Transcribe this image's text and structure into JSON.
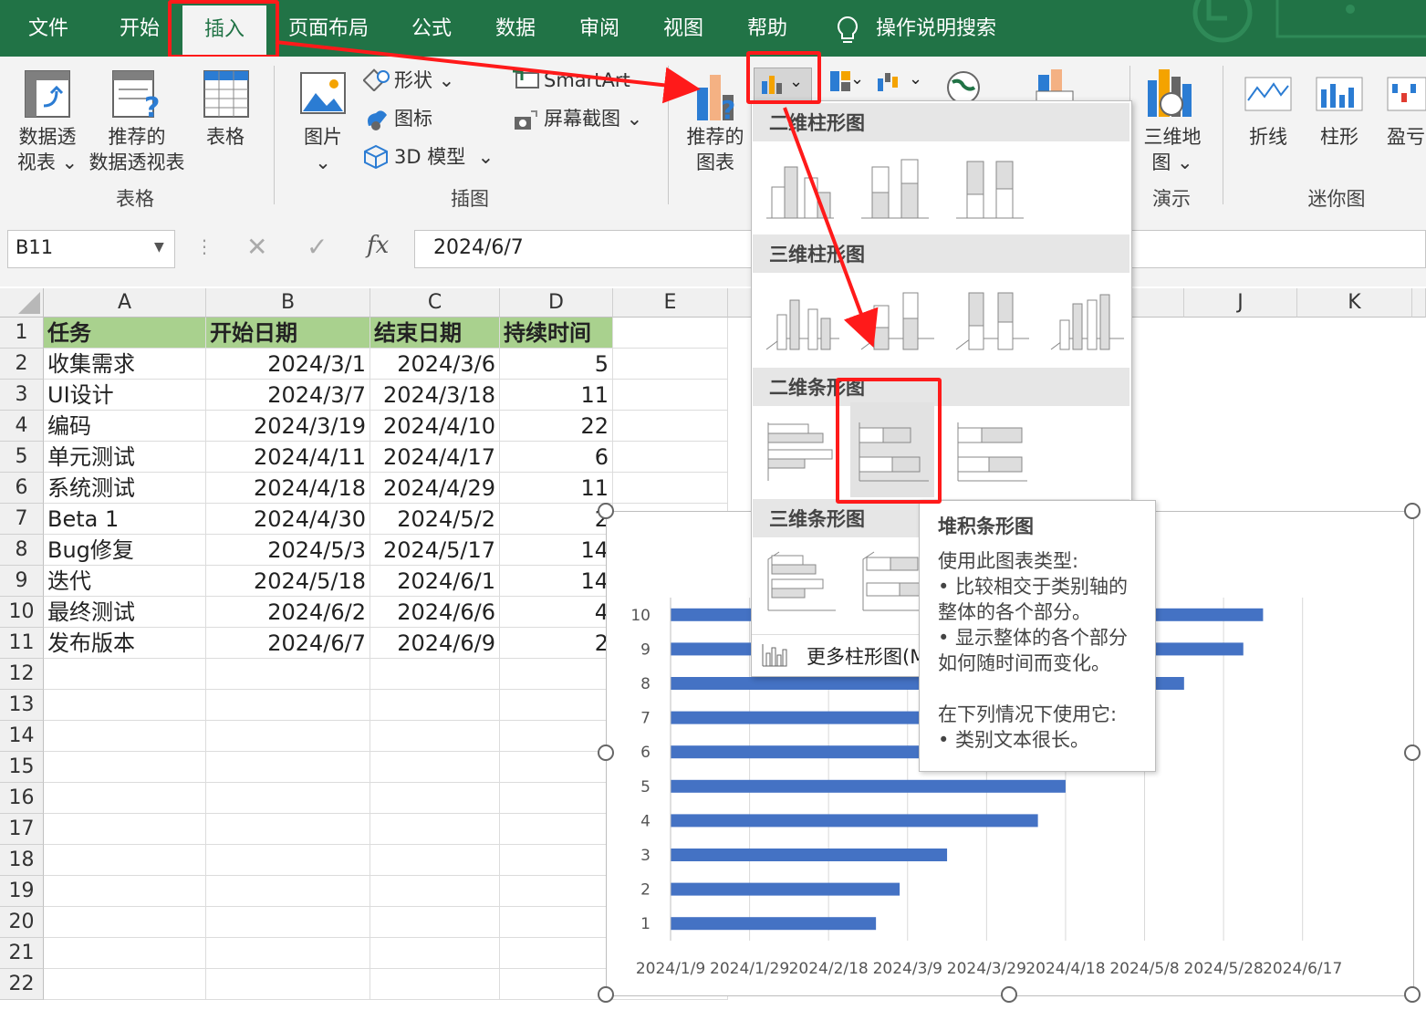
{
  "menu": {
    "items": [
      "文件",
      "开始",
      "插入",
      "页面布局",
      "公式",
      "数据",
      "审阅",
      "视图",
      "帮助"
    ],
    "active": "插入",
    "search_label": "操作说明搜索"
  },
  "ribbon": {
    "pivot_label_1": "数据透",
    "pivot_label_2": "视表",
    "rec_pivot_label_1": "推荐的",
    "rec_pivot_label_2": "数据透视表",
    "table_label": "表格",
    "group_table": "表格",
    "picture_label": "图片",
    "shapes_label": "形状",
    "icons_label": "图标",
    "model3d_label": "3D 模型",
    "smartart_label": "SmartArt",
    "screenshot_label": "屏幕截图",
    "group_illustrations": "插图",
    "rec_chart_label_1": "推荐的",
    "rec_chart_label_2": "图表",
    "map3d_label_1": "三维地",
    "map3d_label_2": "图",
    "group_tours": "演示",
    "spark_line": "折线",
    "spark_column": "柱形",
    "spark_winloss": "盈亏",
    "group_sparklines": "迷你图"
  },
  "formula_bar": {
    "name_box": "B11",
    "fx": "fx",
    "value": "2024/6/7"
  },
  "columns": [
    "A",
    "B",
    "C",
    "D",
    "E",
    "J",
    "K"
  ],
  "rows": [
    "1",
    "2",
    "3",
    "4",
    "5",
    "6",
    "7",
    "8",
    "9",
    "10",
    "11",
    "12",
    "13",
    "14",
    "15",
    "16",
    "17",
    "18",
    "19",
    "20",
    "21",
    "22"
  ],
  "table": {
    "headers": [
      "任务",
      "开始日期",
      "结束日期",
      "持续时间"
    ],
    "rows": [
      [
        "收集需求",
        "2024/3/1",
        "2024/3/6",
        "5"
      ],
      [
        "UI设计",
        "2024/3/7",
        "2024/3/18",
        "11"
      ],
      [
        "编码",
        "2024/3/19",
        "2024/4/10",
        "22"
      ],
      [
        "单元测试",
        "2024/4/11",
        "2024/4/17",
        "6"
      ],
      [
        "系统测试",
        "2024/4/18",
        "2024/4/29",
        "11"
      ],
      [
        "Beta 1",
        "2024/4/30",
        "2024/5/2",
        "2"
      ],
      [
        "Bug修复",
        "2024/5/3",
        "2024/5/17",
        "14"
      ],
      [
        "迭代",
        "2024/5/18",
        "2024/6/1",
        "14"
      ],
      [
        "最终测试",
        "2024/6/2",
        "2024/6/6",
        "4"
      ],
      [
        "发布版本",
        "2024/6/7",
        "2024/6/9",
        "2"
      ]
    ]
  },
  "dropdown": {
    "section_2d_column": "二维柱形图",
    "section_3d_column": "三维柱形图",
    "section_2d_bar": "二维条形图",
    "section_3d_bar": "三维条形图",
    "more": "更多柱形图(M)..."
  },
  "tooltip": {
    "title": "堆积条形图",
    "line1": "使用此图表类型:",
    "line2": "• 比较相交于类别轴的",
    "line3": "整体的各个部分。",
    "line4": "• 显示整体的各个部分",
    "line5": "如何随时间而变化。",
    "line6": "在下列情况下使用它:",
    "line7": "• 类别文本很长。"
  },
  "colors": {
    "excel_green": "#217346",
    "bar": "#4472c4",
    "header_fill": "#a9d18e",
    "highlight": "#ff1a1a"
  },
  "chart_data": {
    "type": "bar",
    "orientation": "horizontal",
    "categories": [
      "1",
      "2",
      "3",
      "4",
      "5",
      "6",
      "7",
      "8",
      "9",
      "10"
    ],
    "values": [
      "2024/3/1",
      "2024/3/7",
      "2024/3/19",
      "2024/4/11",
      "2024/4/18",
      "2024/4/30",
      "2024/5/3",
      "2024/5/18",
      "2024/6/2",
      "2024/6/7"
    ],
    "x_ticks": [
      "2024/1/9",
      "2024/1/29",
      "2024/2/18",
      "2024/3/9",
      "2024/3/29",
      "2024/4/18",
      "2024/5/8",
      "2024/5/28",
      "2024/6/17"
    ],
    "xlim": [
      "2024/1/9",
      "2024/6/27"
    ],
    "grid": "vertical"
  }
}
